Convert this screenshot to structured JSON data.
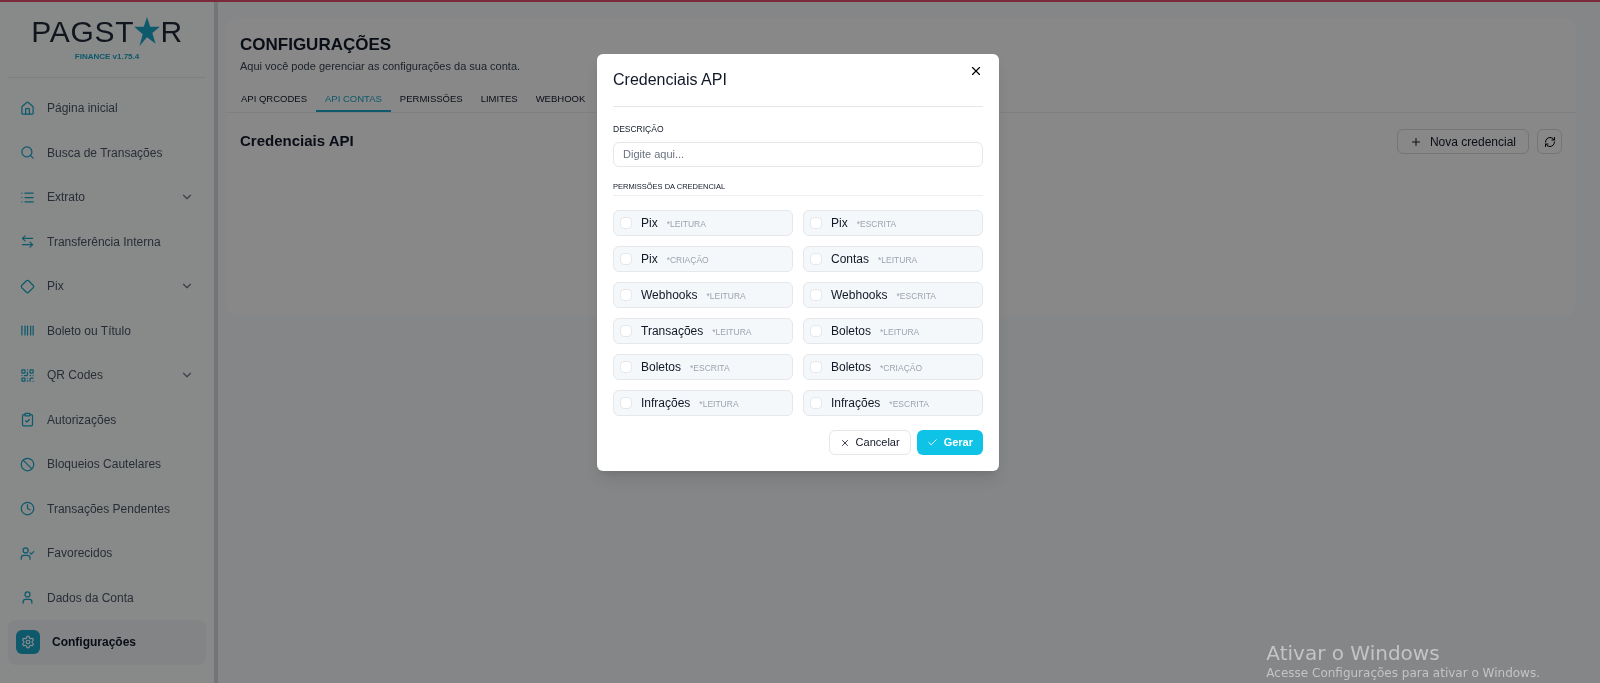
{
  "logo": {
    "text_start": "PAGST",
    "text_end": "R",
    "version": "FINANCE v1.75.4"
  },
  "sidebar": {
    "items": [
      {
        "label": "Página inicial",
        "expandable": false,
        "selected": false
      },
      {
        "label": "Busca de Transações",
        "expandable": false,
        "selected": false
      },
      {
        "label": "Extrato",
        "expandable": true,
        "selected": false
      },
      {
        "label": "Transferência Interna",
        "expandable": false,
        "selected": false
      },
      {
        "label": "Pix",
        "expandable": true,
        "selected": false
      },
      {
        "label": "Boleto ou Título",
        "expandable": false,
        "selected": false
      },
      {
        "label": "QR Codes",
        "expandable": true,
        "selected": false
      },
      {
        "label": "Autorizações",
        "expandable": false,
        "selected": false
      },
      {
        "label": "Bloqueios Cautelares",
        "expandable": false,
        "selected": false
      },
      {
        "label": "Transações Pendentes",
        "expandable": false,
        "selected": false
      },
      {
        "label": "Favorecidos",
        "expandable": false,
        "selected": false
      },
      {
        "label": "Dados da Conta",
        "expandable": false,
        "selected": false
      },
      {
        "label": "Configurações",
        "expandable": false,
        "selected": true
      }
    ]
  },
  "page": {
    "title": "CONFIGURAÇÕES",
    "subtitle": "Aqui você pode gerenciar as configurações da sua conta.",
    "tabs": [
      {
        "label": "API QRCODES",
        "selected": false
      },
      {
        "label": "API CONTAS",
        "selected": true
      },
      {
        "label": "PERMISSÕES",
        "selected": false
      },
      {
        "label": "LIMITES",
        "selected": false
      },
      {
        "label": "WEBHOOK",
        "selected": false
      }
    ],
    "section_title": "Credenciais API",
    "new_button": "Nova credencial"
  },
  "modal": {
    "title": "Credenciais API",
    "description_label": "DESCRIÇÃO",
    "description_placeholder": "Digite aqui...",
    "permissions_label": "PERMISSÕES DA CREDENCIAL",
    "permissions": [
      {
        "name": "Pix",
        "scope": "*LEITURA",
        "checked": false
      },
      {
        "name": "Pix",
        "scope": "*ESCRITA",
        "checked": false
      },
      {
        "name": "Pix",
        "scope": "*CRIAÇÃO",
        "checked": false
      },
      {
        "name": "Contas",
        "scope": "*LEITURA",
        "checked": false
      },
      {
        "name": "Webhooks",
        "scope": "*LEITURA",
        "checked": false
      },
      {
        "name": "Webhooks",
        "scope": "*ESCRITA",
        "checked": false
      },
      {
        "name": "Transações",
        "scope": "*LEITURA",
        "checked": false
      },
      {
        "name": "Boletos",
        "scope": "*LEITURA",
        "checked": false
      },
      {
        "name": "Boletos",
        "scope": "*ESCRITA",
        "checked": false
      },
      {
        "name": "Boletos",
        "scope": "*CRIAÇÃO",
        "checked": false
      },
      {
        "name": "Infrações",
        "scope": "*LEITURA",
        "checked": false
      },
      {
        "name": "Infrações",
        "scope": "*ESCRITA",
        "checked": false
      }
    ],
    "cancel_button": "Cancelar",
    "submit_button": "Gerar"
  },
  "os_notice": {
    "title": "Ativar o Windows",
    "text": "Acesse Configurações para ativar o Windows."
  }
}
